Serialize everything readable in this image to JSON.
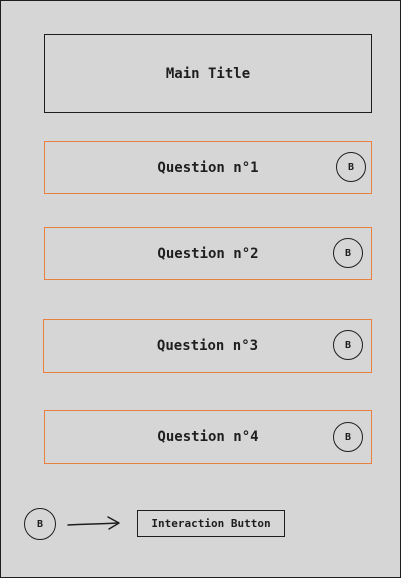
{
  "main_title": "Main Title",
  "questions": [
    {
      "label": "Question n°1",
      "button": "B"
    },
    {
      "label": "Question n°2",
      "button": "B"
    },
    {
      "label": "Question n°3",
      "button": "B"
    },
    {
      "label": "Question n°4",
      "button": "B"
    }
  ],
  "legend": {
    "symbol": "B",
    "description": "Interaction Button"
  },
  "colors": {
    "background": "#d6d6d6",
    "stroke": "#1e1e1e",
    "question_border": "#e8813f"
  }
}
